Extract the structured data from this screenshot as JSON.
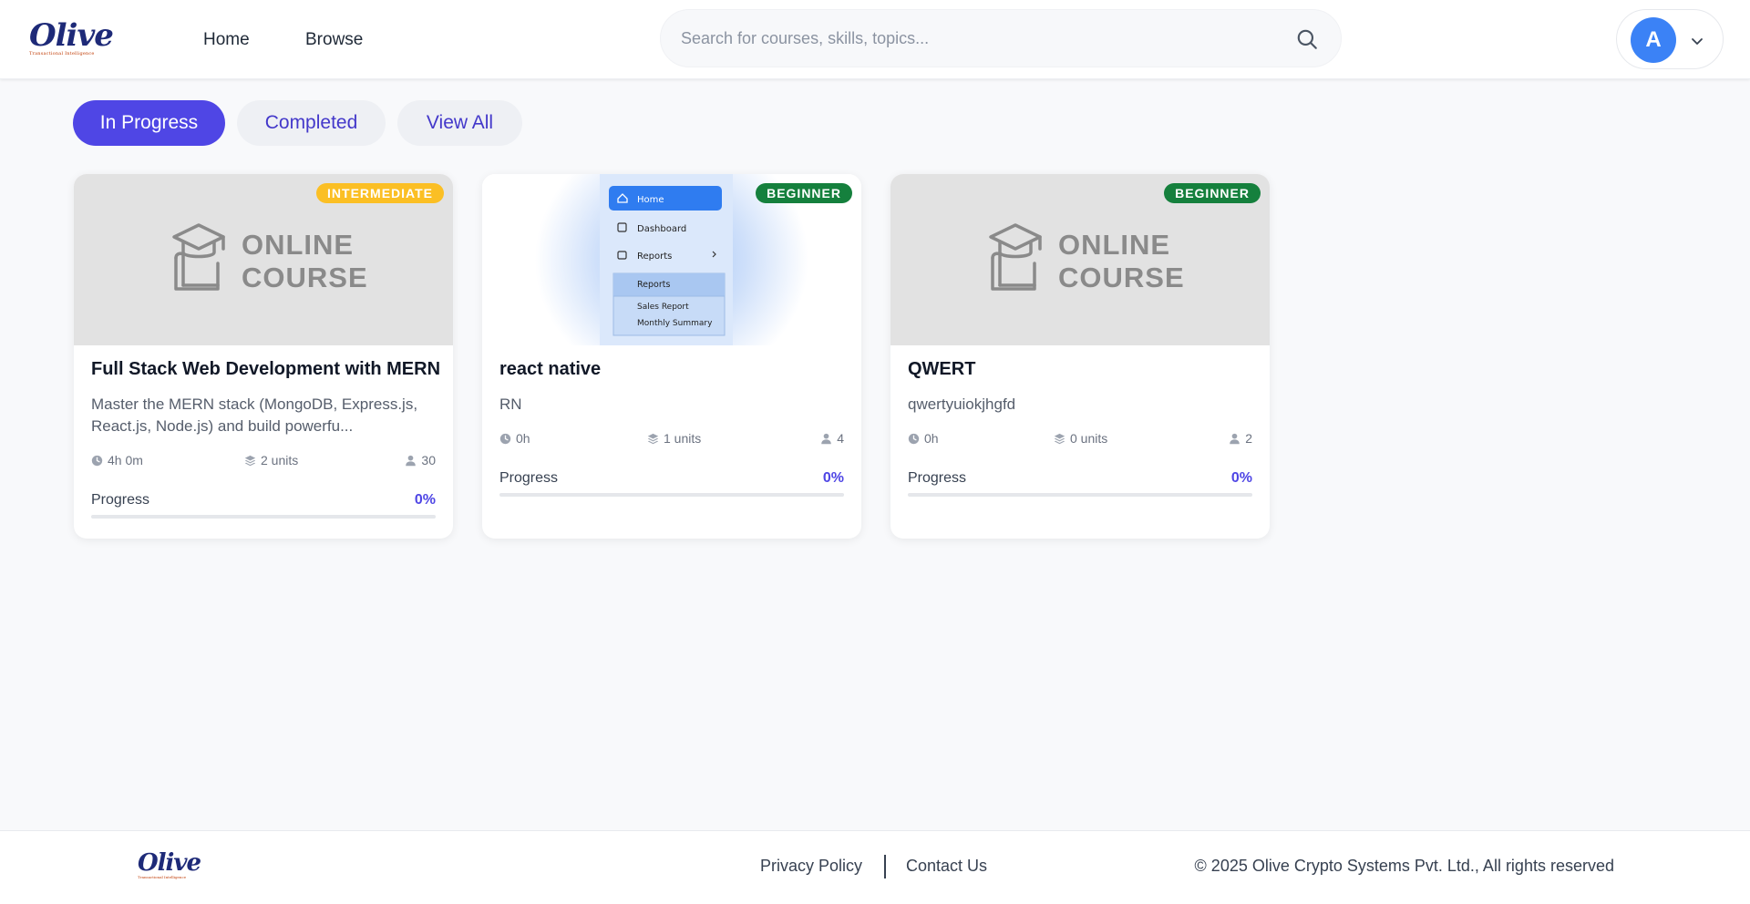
{
  "brand": {
    "name": "Olive",
    "tagline": "Transactional Intelligence"
  },
  "nav": {
    "home": "Home",
    "browse": "Browse"
  },
  "search": {
    "placeholder": "Search for courses, skills, topics..."
  },
  "user": {
    "initial": "A"
  },
  "tabs": [
    {
      "label": "In Progress",
      "active": true
    },
    {
      "label": "Completed",
      "active": false
    },
    {
      "label": "View All",
      "active": false
    }
  ],
  "courses": [
    {
      "level": "INTERMEDIATE",
      "thumb_text": [
        "ONLINE",
        "COURSE"
      ],
      "title": "Full Stack Web Development with MERN",
      "description": "Master the MERN stack (MongoDB, Express.js, React.js, Node.js) and build powerfu...",
      "duration": "4h 0m",
      "units": "2 units",
      "learners": "30",
      "progress_label": "Progress",
      "progress": "0%"
    },
    {
      "level": "BEGINNER",
      "thumb_menu": [
        "Home",
        "Dashboard",
        "Reports",
        "Reports",
        "Sales Report",
        "Monthly Summary"
      ],
      "title": "react native",
      "description": "RN",
      "duration": "0h",
      "units": "1 units",
      "learners": "4",
      "progress_label": "Progress",
      "progress": "0%"
    },
    {
      "level": "BEGINNER",
      "thumb_text": [
        "ONLINE",
        "COURSE"
      ],
      "title": "QWERT",
      "description": "qwertyuiokjhgfd",
      "duration": "0h",
      "units": "0 units",
      "learners": "2",
      "progress_label": "Progress",
      "progress": "0%"
    }
  ],
  "footer": {
    "privacy": "Privacy Policy",
    "contact": "Contact Us",
    "copyright": "© 2025 Olive Crypto Systems Pvt. Ltd., All rights reserved"
  },
  "colors": {
    "accent": "#4f46e5",
    "intermediate": "#fbbf24",
    "beginner": "#15803d",
    "avatar": "#3b82f6"
  }
}
